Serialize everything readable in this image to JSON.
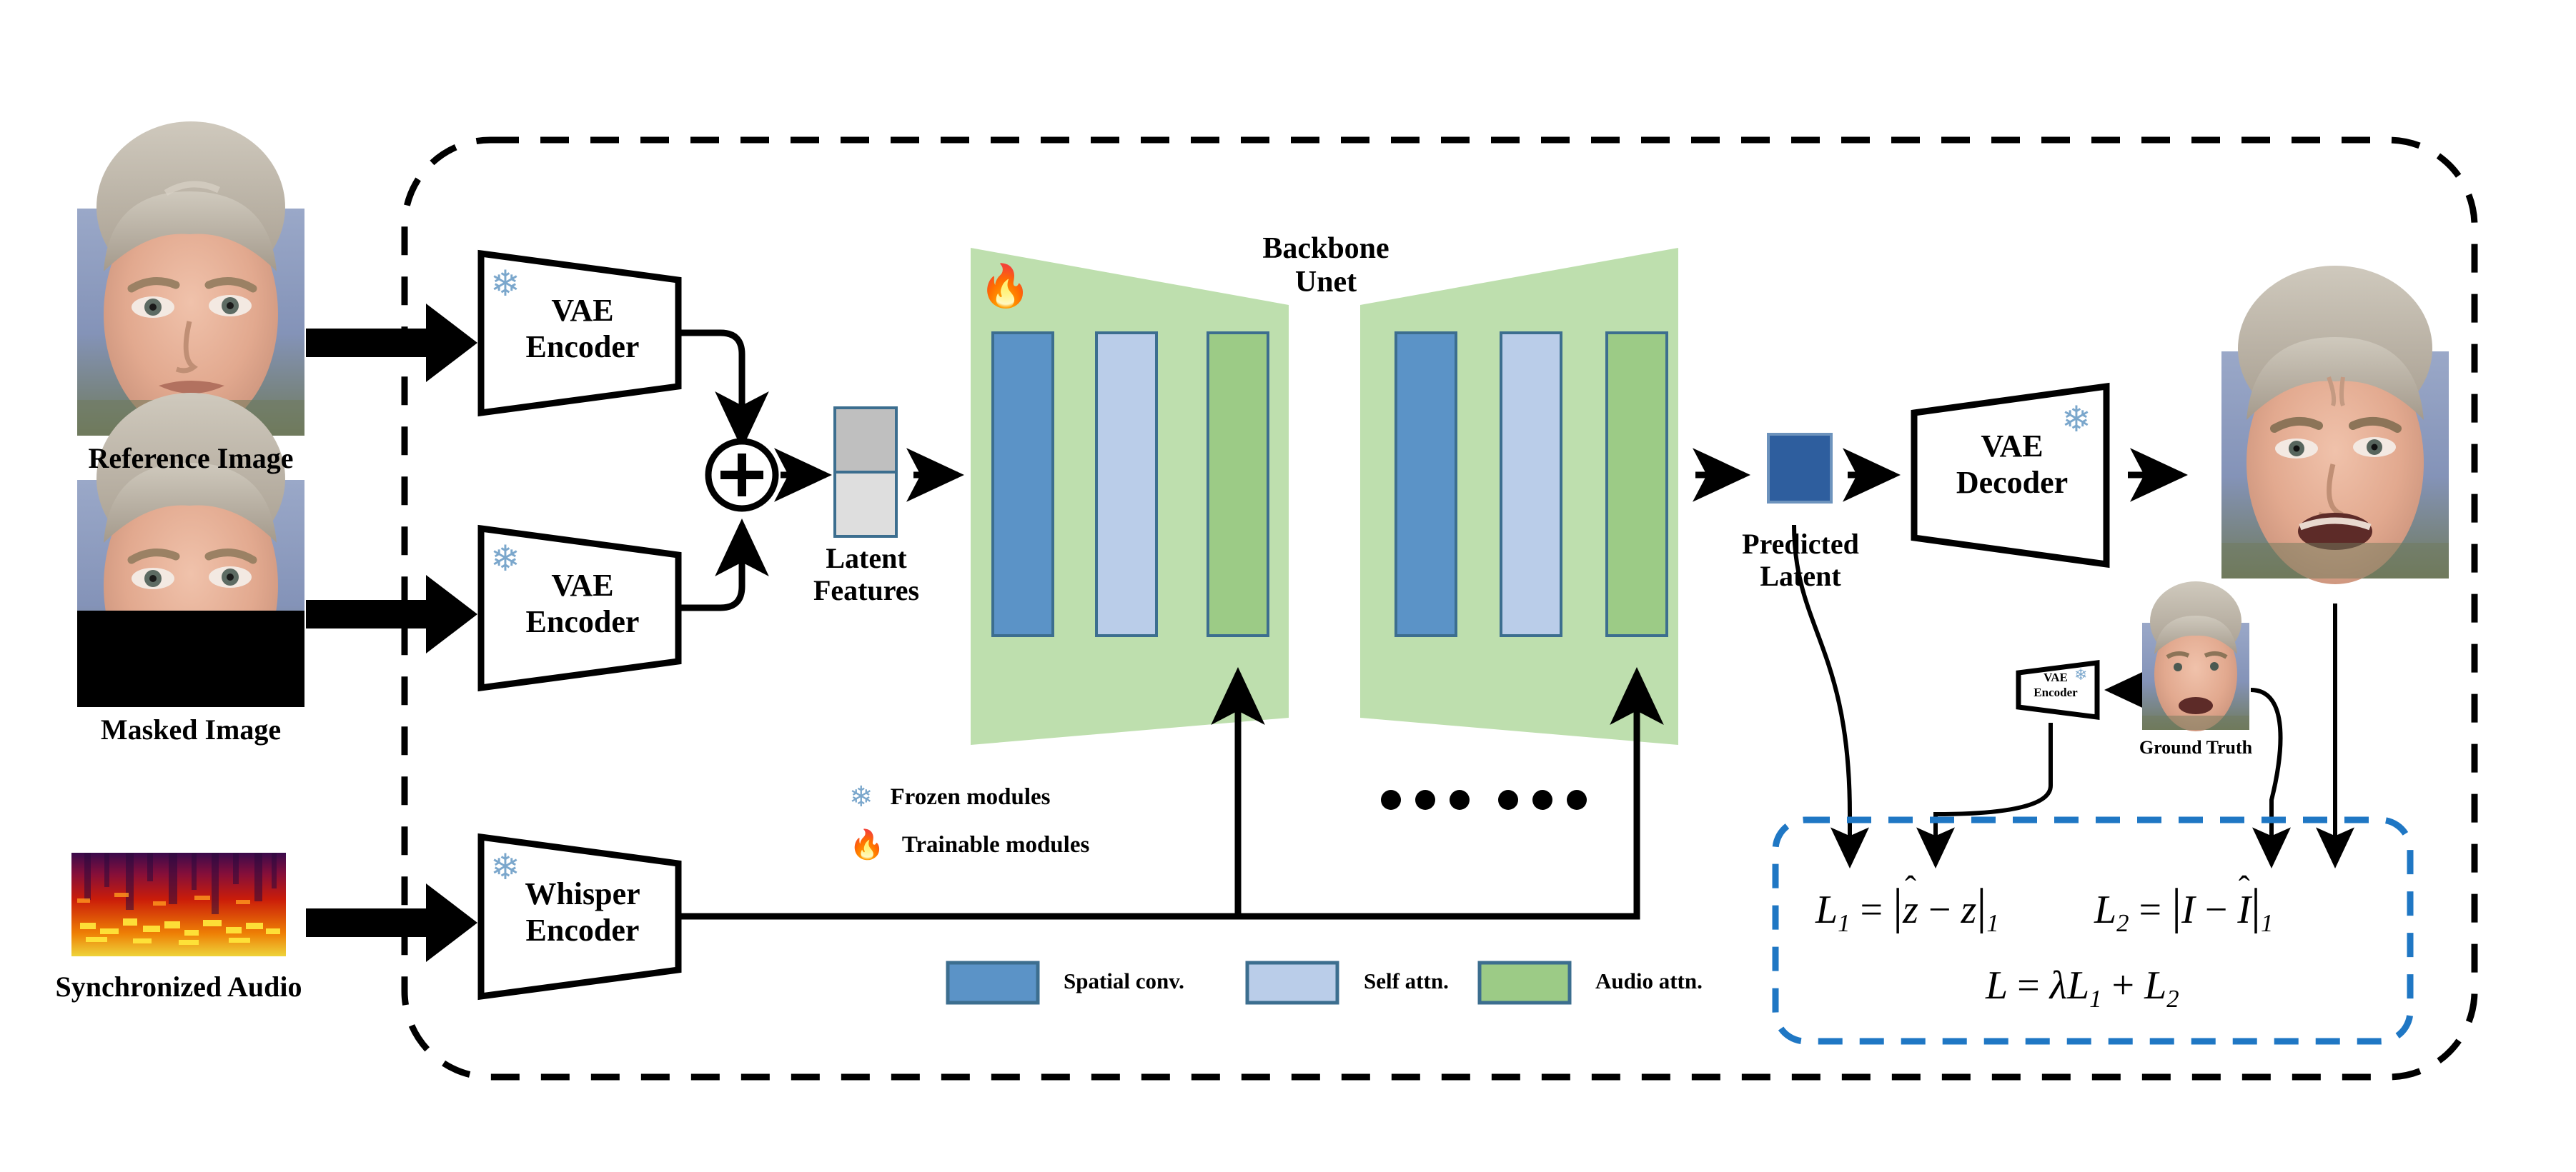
{
  "figure": {
    "title": "Audio-driven talking-head latent diffusion training pipeline",
    "outer_border_color": "#000000",
    "outer_border_style": "dashed-rounded"
  },
  "inputs": [
    {
      "id": "reference-image",
      "label": "Reference Image",
      "kind": "face-photo"
    },
    {
      "id": "masked-image",
      "label": "Masked Image",
      "kind": "face-photo-masked"
    },
    {
      "id": "synchronized-audio",
      "label": "Synchronized Audio",
      "kind": "mel-spectrogram"
    }
  ],
  "encoders": [
    {
      "id": "vae-encoder-reference",
      "line1": "VAE",
      "line2": "Encoder",
      "frozen": true
    },
    {
      "id": "vae-encoder-masked",
      "line1": "VAE",
      "line2": "Encoder",
      "frozen": true
    },
    {
      "id": "whisper-encoder",
      "line1": "Whisper",
      "line2": "Encoder",
      "frozen": true
    }
  ],
  "combine": {
    "operator": "+",
    "name": "sum-node"
  },
  "latent_features": {
    "label_line1": "Latent",
    "label_line2": "Features"
  },
  "backbone": {
    "title_line1": "Backbone",
    "title_line2": "Unet",
    "trainable": true,
    "body_color": "#bedfae",
    "ellipsis": "•••  •••",
    "blocks": [
      {
        "type": "spatial-conv",
        "color": "#5b93c7"
      },
      {
        "type": "self-attn",
        "color": "#bacde9"
      },
      {
        "type": "audio-attn",
        "color": "#9ccb86"
      }
    ]
  },
  "predicted_latent": {
    "label_line1": "Predicted",
    "label_line2": "Latent",
    "color": "#2e5e9e"
  },
  "decoder": {
    "id": "vae-decoder",
    "line1": "VAE",
    "line2": "Decoder",
    "frozen": true
  },
  "output_image": {
    "id": "generated-image",
    "kind": "face-photo"
  },
  "ground_truth": {
    "label": "Ground Truth",
    "encoder_line1": "VAE",
    "encoder_line2": "Encoder",
    "frozen": true
  },
  "module_legend": [
    {
      "icon": "snowflake-icon",
      "glyph": "❄",
      "label": "Frozen modules",
      "color": "#7ba7cc"
    },
    {
      "icon": "fire-icon",
      "glyph": "🔥",
      "label": "Trainable modules",
      "color": "#f4701f"
    }
  ],
  "block_legend": [
    {
      "label": "Spatial conv.",
      "color": "#5b93c7",
      "border": "#3c6e8f"
    },
    {
      "label": "Self attn.",
      "color": "#bacde9",
      "border": "#3c6e8f"
    },
    {
      "label": "Audio attn.",
      "color": "#9ccb86",
      "border": "#3c6e8f"
    }
  ],
  "loss_box": {
    "border_color": "#1f77c4",
    "border_style": "dashed-rounded",
    "equations": [
      {
        "id": "loss-l1",
        "latex": "L_1 = |\\hat{z} - z|_1",
        "parts": {
          "lhs": "L",
          "lhs_sub": "1",
          "eq": "=",
          "bar": "|",
          "a": "z",
          "a_hat": "̂",
          "minus": "−",
          "b": "z",
          "norm_sub": "1"
        }
      },
      {
        "id": "loss-l2",
        "latex": "L_2 = |I - \\hat{I}|_1",
        "parts": {
          "lhs": "L",
          "lhs_sub": "2",
          "eq": "=",
          "bar": "|",
          "a": "I",
          "minus": "−",
          "b": "I",
          "b_hat": "̂",
          "norm_sub": "1"
        }
      },
      {
        "id": "loss-total",
        "latex": "L = \\lambda L_1 + L_2",
        "parts": {
          "lhs": "L",
          "eq": "=",
          "lambda": "λ",
          "t1": "L",
          "t1_sub": "1",
          "plus": "+",
          "t2": "L",
          "t2_sub": "2"
        }
      }
    ]
  },
  "colors": {
    "unet_body": "#bedfae",
    "spatial_conv": "#5b93c7",
    "self_attn": "#bacde9",
    "audio_attn": "#9ccb86",
    "block_border": "#3c6e8f",
    "predicted_latent": "#2e5e9e",
    "latent_top": "#bfbfbf",
    "latent_bottom": "#dedede",
    "loss_border": "#1f77c4",
    "snowflake": "#7ba7cc",
    "fire": "#f4701f"
  }
}
